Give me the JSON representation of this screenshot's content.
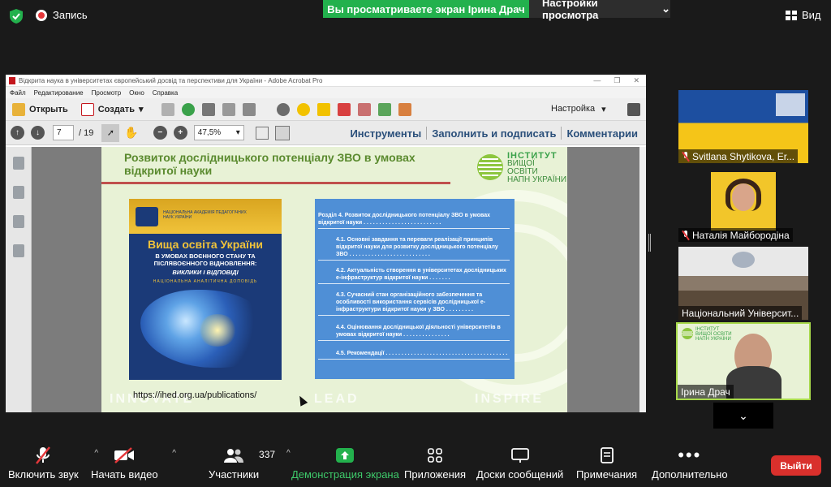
{
  "top_bar": {
    "record_label": "Запись",
    "share_banner": "Вы просматриваете экран Ірина Драч",
    "view_options_label": "Настройки просмотра",
    "view_label": "Вид"
  },
  "acrobat": {
    "window_title": "Відкрита наука в університетах  європейський досвід та перспективи для України - Adobe Acrobat Pro",
    "menu": [
      "Файл",
      "Редактирование",
      "Просмотр",
      "Окно",
      "Справка"
    ],
    "open_label": "Открыть",
    "create_label": "Создать",
    "customize_label": "Настройка",
    "page_current": "7",
    "page_total": "/ 19",
    "zoom": "47,5%",
    "panel_tools": "Инструменты",
    "panel_fill_sign": "Заполнить и подписать",
    "panel_comments": "Комментарии"
  },
  "slide": {
    "title": "Розвиток дослідницького потенціалу ЗВО в умовах відкритої науки",
    "institute_lines": [
      "ІНСТИТУТ",
      "ВИЩОЇ ОСВІТИ",
      "НАПН УКРАЇНИ"
    ],
    "watermarks": [
      "INNOVATE",
      "LEAD",
      "INSPIRE"
    ],
    "book": {
      "publisher": "НАЦІОНАЛЬНА АКАДЕМІЯ ПЕДАГОГІЧНИХ НАУК УКРАЇНИ",
      "title": "Вища освіта України",
      "subtitle": "В УМОВАХ ВОЄННОГО СТАНУ ТА ПІСЛЯВОЄННОГО ВІДНОВЛЕННЯ:",
      "subtitle2": "ВИКЛИКИ І ВІДПОВІДІ",
      "band": "НАЦІОНАЛЬНА АНАЛІТИЧНА ДОПОВІДЬ"
    },
    "toc": [
      "Розділ 4. Розвиток дослідницького потенціалу ЗВО в умовах відкритої науки . . . . . . . . . . . . . . . . . . . . . . . . .",
      "4.1. Основні завдання та переваги реалізації принципів відкритої науки для розвитку дослідницького потенціалу ЗВО . . . . . . . . . . . . . . . . . . . . . . . . . .",
      "4.2. Актуальність створення в університетах дослідницьких е-інфраструктур відкритої науки . . . . . . .",
      "4.3. Сучасний стан організаційного забезпечення та особливості використання сервісів дослідницької е-інфраструктури відкритої науки у ЗВО . . . . . . . . .",
      "4.4. Оцінювання дослідницької діяльності університетів в умовах відкритої науки . . . . . . . . . . . . . . .",
      "4.5. Рекомендації . . . . . . . . . . . . . . . . . . . . . . . . . . . . . . . . . . . . . . ."
    ],
    "url": "https://ihed.org.ua/publications/"
  },
  "participants": [
    {
      "name": "Svitlana Shytikova, Er...",
      "muted": true
    },
    {
      "name": "Наталія Майбородіна",
      "muted": true
    },
    {
      "name": "Національний Університ...",
      "muted": false
    },
    {
      "name": "Ірина Драч",
      "muted": false
    }
  ],
  "bottom_bar": {
    "audio": "Включить звук",
    "video": "Начать видео",
    "participants": "Участники",
    "participants_count": "337",
    "share": "Демонстрация экрана",
    "apps": "Приложения",
    "whiteboards": "Доски сообщений",
    "notes": "Примечания",
    "more": "Дополнительно",
    "leave": "Выйти"
  },
  "colors": {
    "share_green": "#23b14d",
    "leave_red": "#d9302c",
    "slide_title_green": "#5a8a2e",
    "toc_blue": "#4f8fd6"
  }
}
